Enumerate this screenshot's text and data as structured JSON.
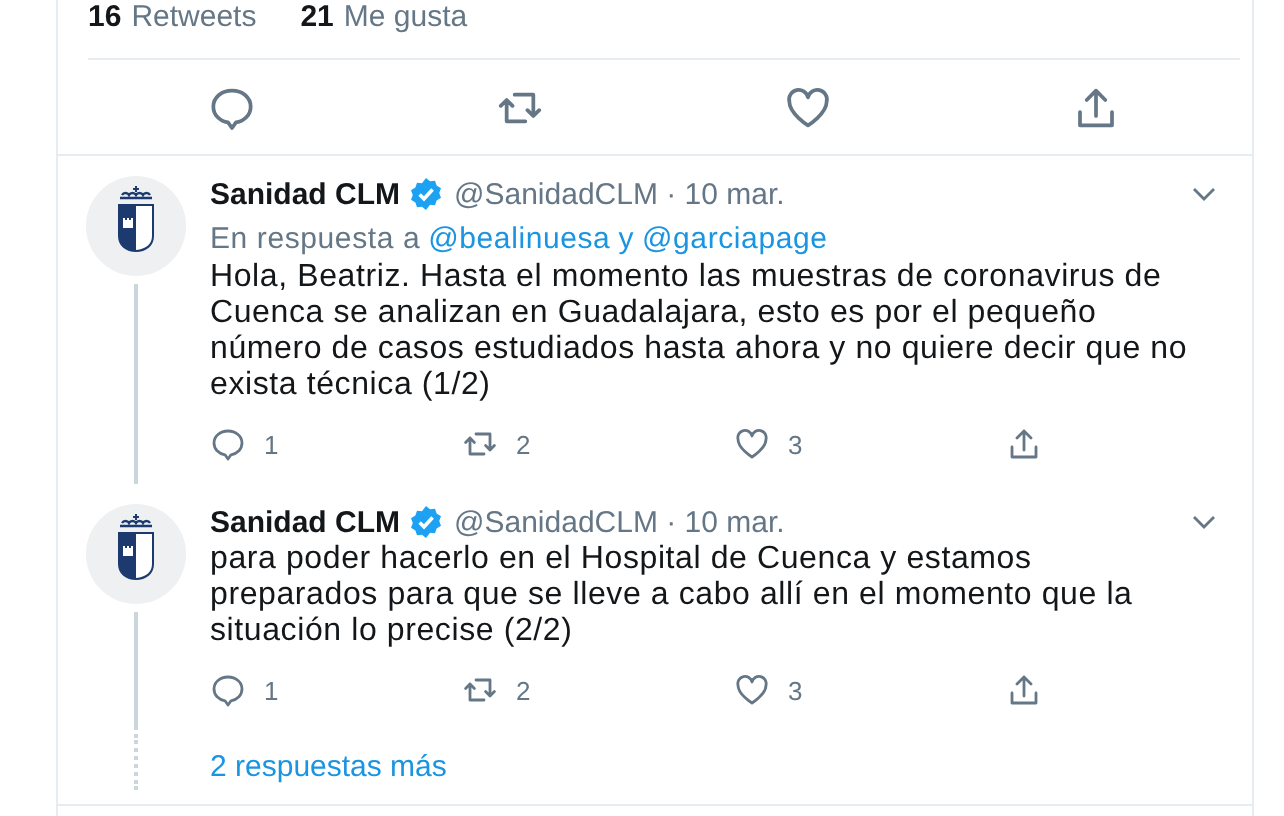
{
  "stats": [
    {
      "count": "16",
      "label": "Retweets"
    },
    {
      "count": "21",
      "label": "Me gusta"
    }
  ],
  "replies": [
    {
      "name": "Sanidad CLM",
      "verified": true,
      "handle_date": "@SanidadCLM · 10 mar.",
      "in_reply_to": {
        "prefix": "En respuesta a",
        "users": [
          "@bealinuesa",
          "@garciapage"
        ],
        "joiner": "y"
      },
      "text": "Hola, Beatriz. Hasta el momento las muestras de coronavirus de Cuenca se analizan en Guadalajara, esto es por el pequeño número de casos estudiados hasta ahora y no quiere decir que no exista técnica (1/2)",
      "reply_count": "1",
      "retweet_count": "2",
      "like_count": "3"
    },
    {
      "name": "Sanidad CLM",
      "verified": true,
      "handle_date": "@SanidadCLM · 10 mar.",
      "text": "para poder hacerlo en el Hospital de Cuenca y estamos preparados para que se lleve a cabo allí en el momento que la situación lo precise (2/2)",
      "reply_count": "1",
      "retweet_count": "2",
      "like_count": "3"
    }
  ],
  "more_replies": "2 respuestas más"
}
